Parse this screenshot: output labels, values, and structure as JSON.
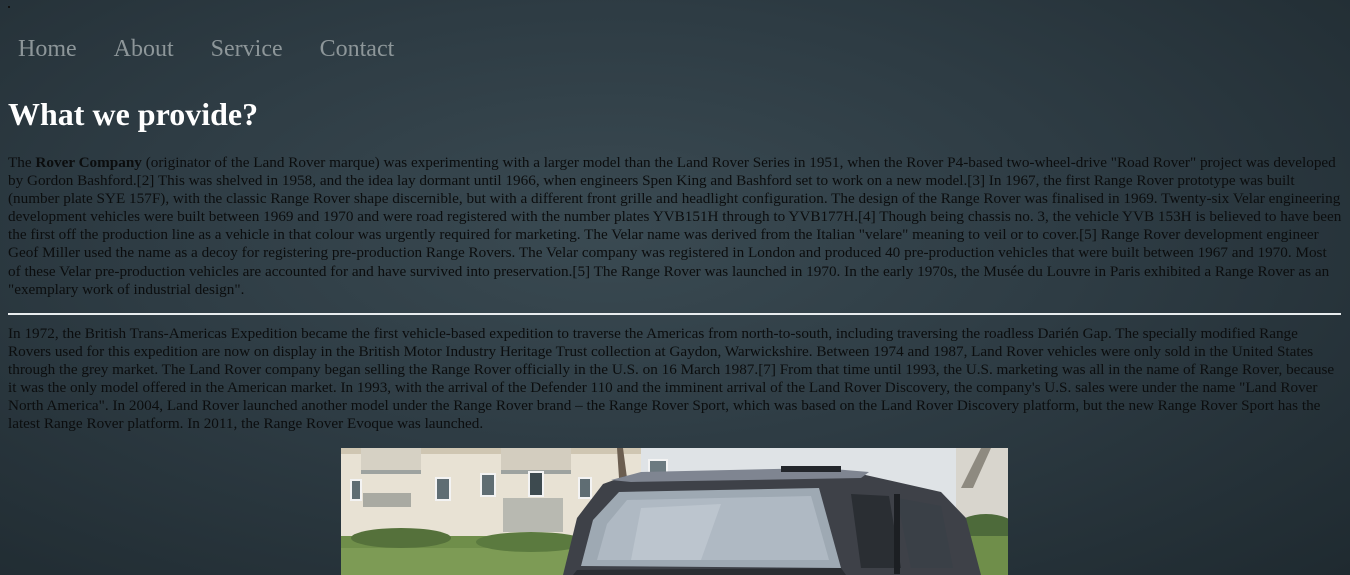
{
  "nav": {
    "items": [
      "Home",
      "About",
      "Service",
      "Contact"
    ]
  },
  "heading": "What we provide?",
  "paragraph1": {
    "pre": "The ",
    "bold": "Rover Company",
    "text": " (originator of the Land Rover marque) was experimenting with a larger model than the Land Rover Series in 1951, when the Rover P4-based two-wheel-drive \"Road Rover\" project was developed by Gordon Bashford.[2] This was shelved in 1958, and the idea lay dormant until 1966, when engineers Spen King and Bashford set to work on a new model.[3] In 1967, the first Range Rover prototype was built (number plate SYE 157F), with the classic Range Rover shape discernible, but with a different front grille and headlight configuration. The design of the Range Rover was finalised in 1969. Twenty-six Velar engineering development vehicles were built between 1969 and 1970 and were road registered with the number plates YVB151H through to YVB177H.[4] Though being chassis no. 3, the vehicle YVB 153H is believed to have been the first off the production line as a vehicle in that colour was urgently required for marketing. The Velar name was derived from the Italian \"velare\" meaning to veil or to cover.[5] Range Rover development engineer Geof Miller used the name as a decoy for registering pre-production Range Rovers. The Velar company was registered in London and produced 40 pre-production vehicles that were built between 1967 and 1970. Most of these Velar pre-production vehicles are accounted for and have survived into preservation.[5] The Range Rover was launched in 1970. In the early 1970s, the Musée du Louvre in Paris exhibited a Range Rover as an \"exemplary work of industrial design\"."
  },
  "paragraph2": "In 1972, the British Trans-Americas Expedition became the first vehicle-based expedition to traverse the Americas from north-to-south, including traversing the roadless Darién Gap. The specially modified Range Rovers used for this expedition are now on display in the British Motor Industry Heritage Trust collection at Gaydon, Warwickshire. Between 1974 and 1987, Land Rover vehicles were only sold in the United States through the grey market. The Land Rover company began selling the Range Rover officially in the U.S. on 16 March 1987.[7] From that time until 1993, the U.S. marketing was all in the name of Range Rover, because it was the only model offered in the American market. In 1993, with the arrival of the Defender 110 and the imminent arrival of the Land Rover Discovery, the company's U.S. sales were under the name \"Land Rover North America\". In 2004, Land Rover launched another model under the Range Rover brand – the Range Rover Sport, which was based on the Land Rover Discovery platform, but the new Range Rover Sport has the latest Range Rover platform. In 2011, the Range Rover Evoque was launched.",
  "colors": {
    "heading": "#ffffff",
    "nav_link": "#8d9699",
    "body_text": "#0b0d0e",
    "rule": "#e8ecee"
  }
}
